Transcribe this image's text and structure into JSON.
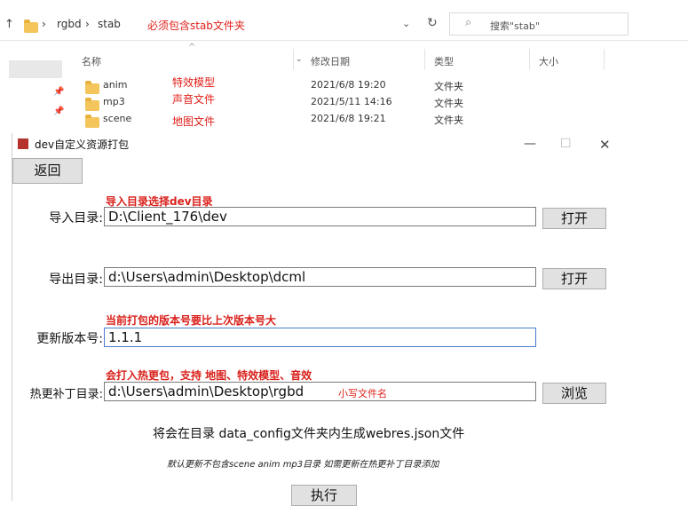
{
  "explorer": {
    "breadcrumb": [
      "rgbd",
      "stab"
    ],
    "breadcrumb_note": "必须包含stab文件夹",
    "search_placeholder": "搜索\"stab\"",
    "columns": [
      "名称",
      "修改日期",
      "类型",
      "大小"
    ],
    "rows": [
      {
        "name": "anim",
        "note": "特效模型",
        "date": "2021/6/8 19:20",
        "type": "文件夹"
      },
      {
        "name": "mp3",
        "note": "声音文件",
        "date": "2021/5/11 14:16",
        "type": "文件夹"
      },
      {
        "name": "scene",
        "note": "地图文件",
        "date": "2021/6/8 19:21",
        "type": "文件夹"
      }
    ]
  },
  "dialog": {
    "title": "dev自定义资源打包",
    "back_label": "返回",
    "import": {
      "hint": "导入目录选择dev目录",
      "label": "导入目录:",
      "value": "D:\\Client_176\\dev",
      "button": "打开"
    },
    "export": {
      "label": "导出目录:",
      "value": "d:\\Users\\admin\\Desktop\\dcml",
      "button": "打开"
    },
    "version": {
      "hint": "当前打包的版本号要比上次版本号大",
      "label": "更新版本号:",
      "value": "1.1.1"
    },
    "patch": {
      "hint": "会打入热更包，支持 地图、特效模型、音效",
      "label": "热更补丁目录:",
      "value": "d:\\Users\\admin\\Desktop\\rgbd",
      "value_note": "小写文件名",
      "button": "浏览"
    },
    "info_text": "将会在目录 data_config文件夹内生成webres.json文件",
    "italic_note": "默认更新不包含scene anim mp3目录 如需更新在热更补丁目录添加",
    "execute_label": "执行"
  }
}
